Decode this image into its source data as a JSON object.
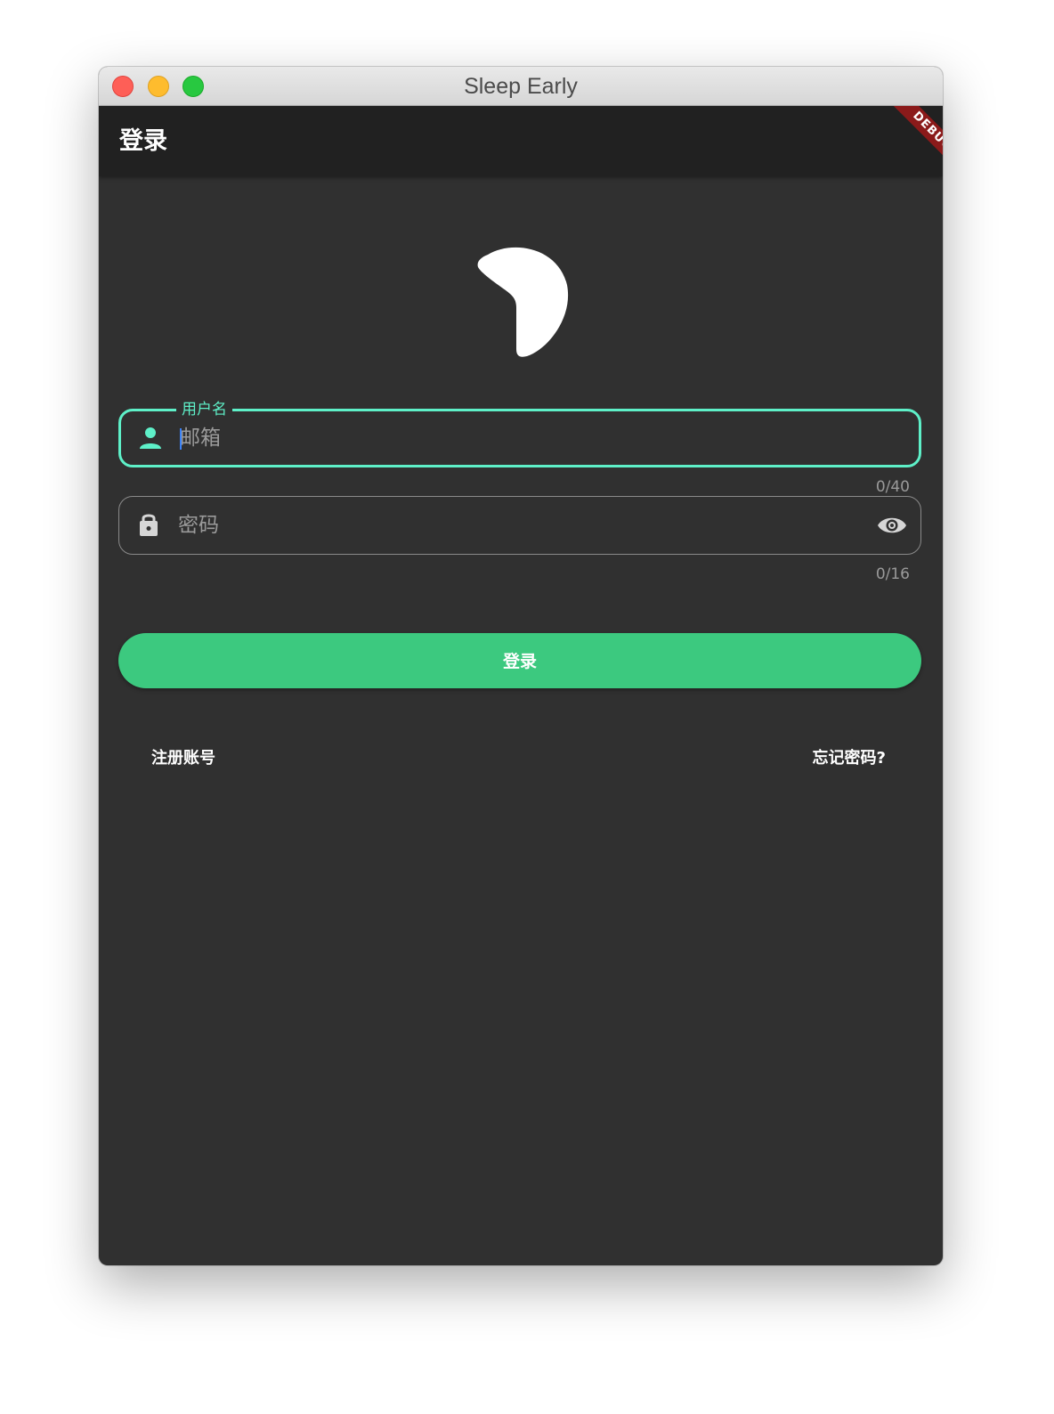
{
  "window": {
    "title": "Sleep Early"
  },
  "appbar": {
    "title": "登录",
    "debug_banner": "DEBUG"
  },
  "username_field": {
    "label": "用户名",
    "placeholder": "邮箱",
    "value": "",
    "counter": "0/40",
    "icon": "person-icon"
  },
  "password_field": {
    "placeholder": "密码",
    "value": "",
    "counter": "0/16",
    "icon": "lock-icon",
    "toggle_icon": "eye-icon"
  },
  "login_button": {
    "label": "登录"
  },
  "links": {
    "register": "注册账号",
    "forgot": "忘记密码?"
  },
  "colors": {
    "accent_teal": "#5ef0c8",
    "button_green": "#3cc97f",
    "background": "#303030",
    "appbar": "#212121"
  }
}
